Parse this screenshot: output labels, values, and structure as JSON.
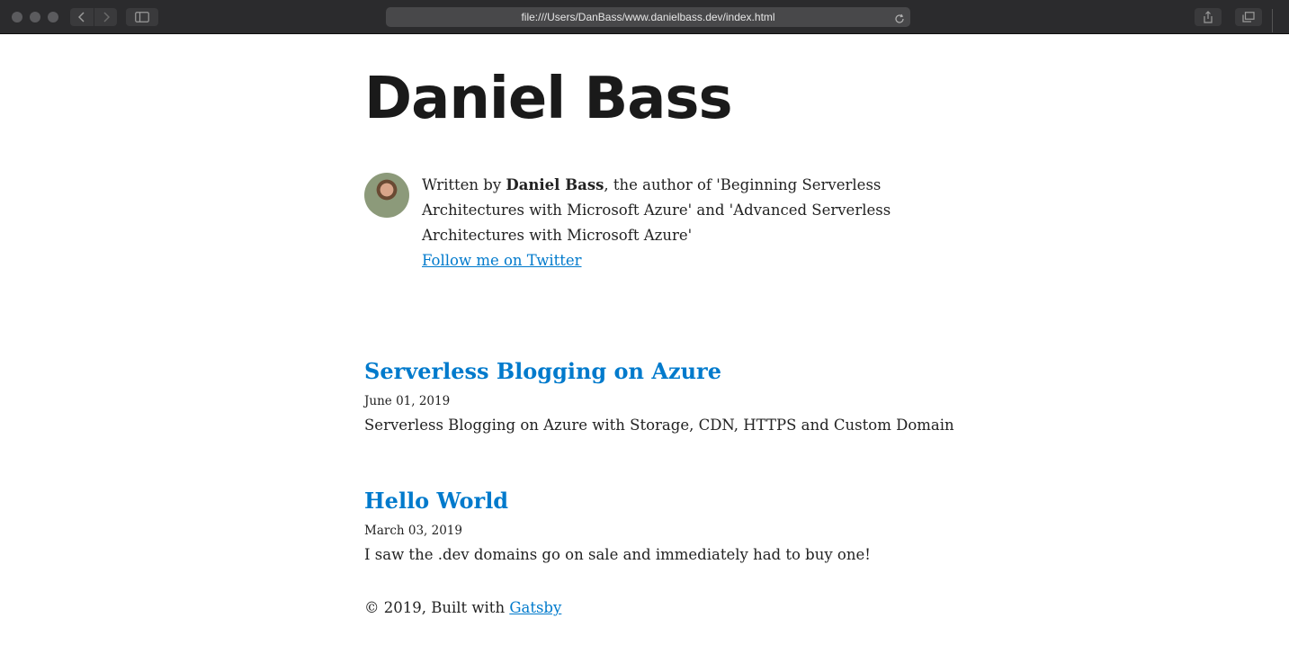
{
  "browser": {
    "url": "file:///Users/DanBass/www.danielbass.dev/index.html"
  },
  "site": {
    "title": "Daniel Bass"
  },
  "bio": {
    "prefix": "Written by ",
    "author": "Daniel Bass",
    "suffix": ", the author of 'Beginning Serverless Architectures with Microsoft Azure' and 'Advanced Serverless Architectures with Microsoft Azure'",
    "twitter_link": "Follow me on Twitter"
  },
  "posts": [
    {
      "title": "Serverless Blogging on Azure",
      "date": "June 01, 2019",
      "excerpt": "Serverless Blogging on Azure with Storage, CDN, HTTPS and Custom Domain"
    },
    {
      "title": "Hello World",
      "date": "March 03, 2019",
      "excerpt": "I saw the .dev domains go on sale and immediately had to buy one!"
    }
  ],
  "footer": {
    "text": "© 2019, Built with ",
    "link": "Gatsby"
  },
  "colors": {
    "link": "#007acc",
    "chrome": "#2b2b2d"
  }
}
